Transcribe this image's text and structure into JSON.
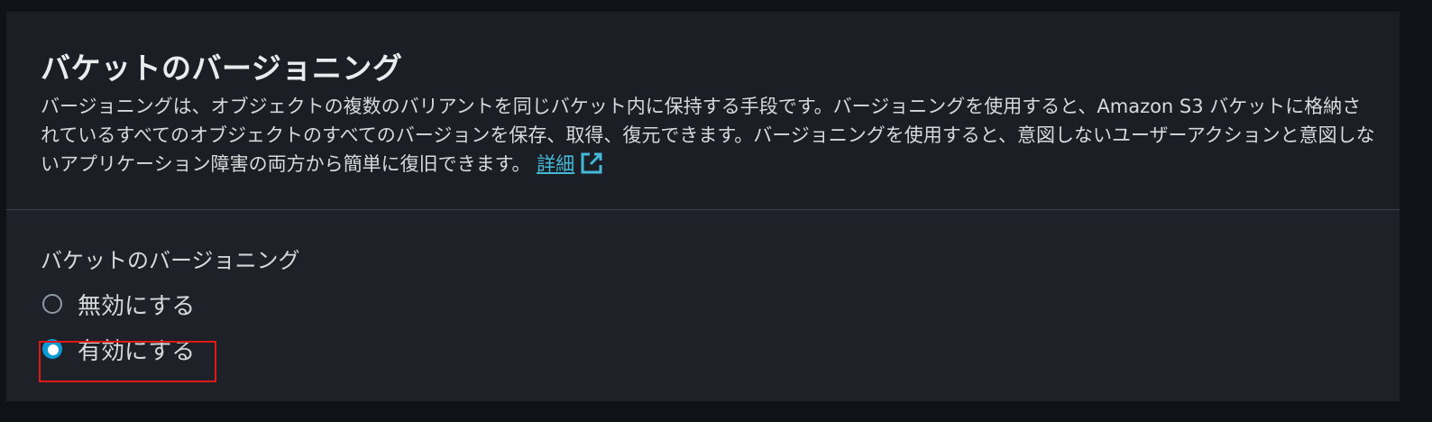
{
  "section": {
    "title": "バケットのバージョニング",
    "description": "バージョニングは、オブジェクトの複数のバリアントを同じバケット内に保持する手段です。バージョニングを使用すると、Amazon S3 バケットに格納されているすべてのオブジェクトのすべてのバージョンを保存、取得、復元できます。バージョニングを使用すると、意図しないユーザーアクションと意図しないアプリケーション障害の両方から簡単に復旧できます。",
    "learn_more_label": "詳細",
    "learn_more_icon": "external-link-icon"
  },
  "versioning_field": {
    "label": "バケットのバージョニング",
    "options": [
      {
        "label": "無効にする",
        "selected": false
      },
      {
        "label": "有効にする",
        "selected": true
      }
    ]
  },
  "colors": {
    "link": "#44b9d6",
    "radio_selected": "#0a9bd4",
    "highlight": "#e01818",
    "panel": "#1b1e24"
  }
}
